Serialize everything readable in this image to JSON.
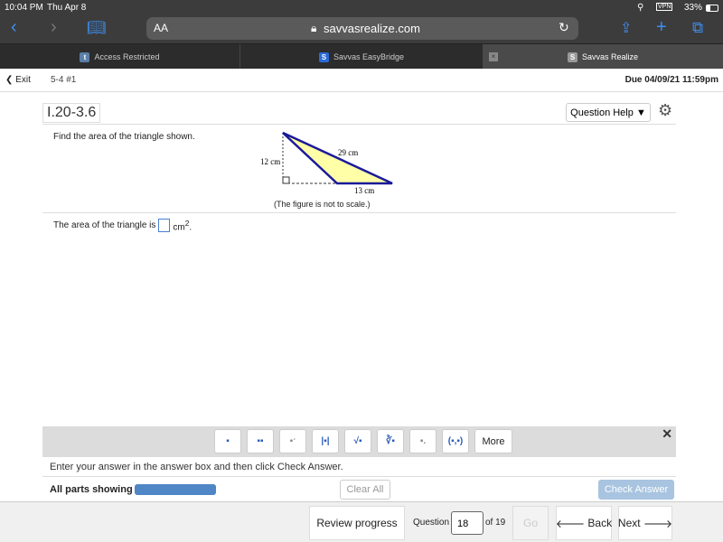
{
  "status": {
    "time": "10:04 PM",
    "date": "Thu Apr 8",
    "battery": "33%",
    "vpn": "VPN"
  },
  "browser": {
    "text_size": "AA",
    "url": "savvasrealize.com",
    "tabs": [
      {
        "label": "Access Restricted",
        "icon": "t"
      },
      {
        "label": "Savvas EasyBridge",
        "icon": "S"
      },
      {
        "label": "Savvas Realize",
        "icon": "S"
      }
    ]
  },
  "header": {
    "exit": "Exit",
    "assignment": "5-4 #1",
    "due": "Due 04/09/21 11:59pm"
  },
  "question": {
    "id": "I.20-3.6",
    "help": "Question Help",
    "prompt": "Find the area of the triangle shown.",
    "figure": {
      "height_label": "12 cm",
      "hyp_label": "29 cm",
      "base_label": "13 cm",
      "note": "(The figure is not to scale.)"
    },
    "answer_prefix": "The area of the triangle is",
    "answer_value": "",
    "answer_unit": "cm",
    "answer_exp": "2",
    "answer_suffix": "."
  },
  "mathtools": {
    "buttons": [
      "fraction",
      "mixed-number",
      "exponent",
      "absolute-value",
      "square-root",
      "nth-root",
      "subscript",
      "ordered-pair"
    ],
    "more": "More"
  },
  "instructions": "Enter your answer in the answer box and then click Check Answer.",
  "parts": {
    "label": "All parts showing",
    "progress": 1.0
  },
  "actions": {
    "clear": "Clear All",
    "check": "Check Answer"
  },
  "nav": {
    "review": "Review progress",
    "question_label": "Question",
    "question_num": "18",
    "of": "of 19",
    "go": "Go",
    "back": "Back",
    "next": "Next"
  }
}
